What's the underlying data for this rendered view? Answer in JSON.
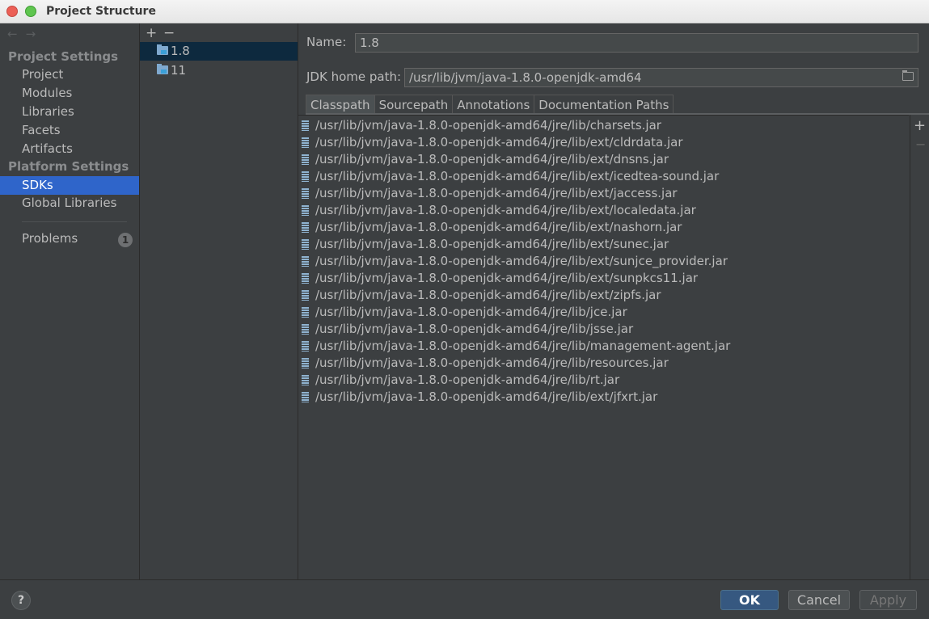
{
  "window": {
    "title": "Project Structure"
  },
  "nav": {
    "back": "←",
    "forward": "→"
  },
  "sidebar": {
    "project_settings_header": "Project Settings",
    "project_items": [
      "Project",
      "Modules",
      "Libraries",
      "Facets",
      "Artifacts"
    ],
    "platform_settings_header": "Platform Settings",
    "sdks": "SDKs",
    "global_libraries": "Global Libraries",
    "problems": "Problems",
    "problems_count": "1"
  },
  "sdk_list": {
    "add": "+",
    "remove": "−",
    "items": [
      "1.8",
      "11"
    ],
    "selected": "1.8"
  },
  "details": {
    "name_label": "Name:",
    "name_value": "1.8",
    "jdk_home_label": "JDK home path:",
    "jdk_home_value": "/usr/lib/jvm/java-1.8.0-openjdk-amd64",
    "tabs": [
      "Classpath",
      "Sourcepath",
      "Annotations",
      "Documentation Paths"
    ],
    "active_tab": "Classpath",
    "classpath": [
      "/usr/lib/jvm/java-1.8.0-openjdk-amd64/jre/lib/charsets.jar",
      "/usr/lib/jvm/java-1.8.0-openjdk-amd64/jre/lib/ext/cldrdata.jar",
      "/usr/lib/jvm/java-1.8.0-openjdk-amd64/jre/lib/ext/dnsns.jar",
      "/usr/lib/jvm/java-1.8.0-openjdk-amd64/jre/lib/ext/icedtea-sound.jar",
      "/usr/lib/jvm/java-1.8.0-openjdk-amd64/jre/lib/ext/jaccess.jar",
      "/usr/lib/jvm/java-1.8.0-openjdk-amd64/jre/lib/ext/localedata.jar",
      "/usr/lib/jvm/java-1.8.0-openjdk-amd64/jre/lib/ext/nashorn.jar",
      "/usr/lib/jvm/java-1.8.0-openjdk-amd64/jre/lib/ext/sunec.jar",
      "/usr/lib/jvm/java-1.8.0-openjdk-amd64/jre/lib/ext/sunjce_provider.jar",
      "/usr/lib/jvm/java-1.8.0-openjdk-amd64/jre/lib/ext/sunpkcs11.jar",
      "/usr/lib/jvm/java-1.8.0-openjdk-amd64/jre/lib/ext/zipfs.jar",
      "/usr/lib/jvm/java-1.8.0-openjdk-amd64/jre/lib/jce.jar",
      "/usr/lib/jvm/java-1.8.0-openjdk-amd64/jre/lib/jsse.jar",
      "/usr/lib/jvm/java-1.8.0-openjdk-amd64/jre/lib/management-agent.jar",
      "/usr/lib/jvm/java-1.8.0-openjdk-amd64/jre/lib/resources.jar",
      "/usr/lib/jvm/java-1.8.0-openjdk-amd64/jre/lib/rt.jar",
      "/usr/lib/jvm/java-1.8.0-openjdk-amd64/jre/lib/ext/jfxrt.jar"
    ],
    "list_add": "+",
    "list_remove": "−"
  },
  "footer": {
    "help": "?",
    "ok": "OK",
    "cancel": "Cancel",
    "apply": "Apply"
  },
  "icons": [
    "close-icon",
    "maximize-icon",
    "back-arrow-icon",
    "forward-arrow-icon",
    "folder-icon",
    "jar-icon",
    "browse-folder-icon",
    "help-icon"
  ],
  "colors": {
    "background": "#3c3f41",
    "selection": "#2f65ca",
    "sdk_selection": "#0d293e",
    "ok_button": "#365880"
  }
}
